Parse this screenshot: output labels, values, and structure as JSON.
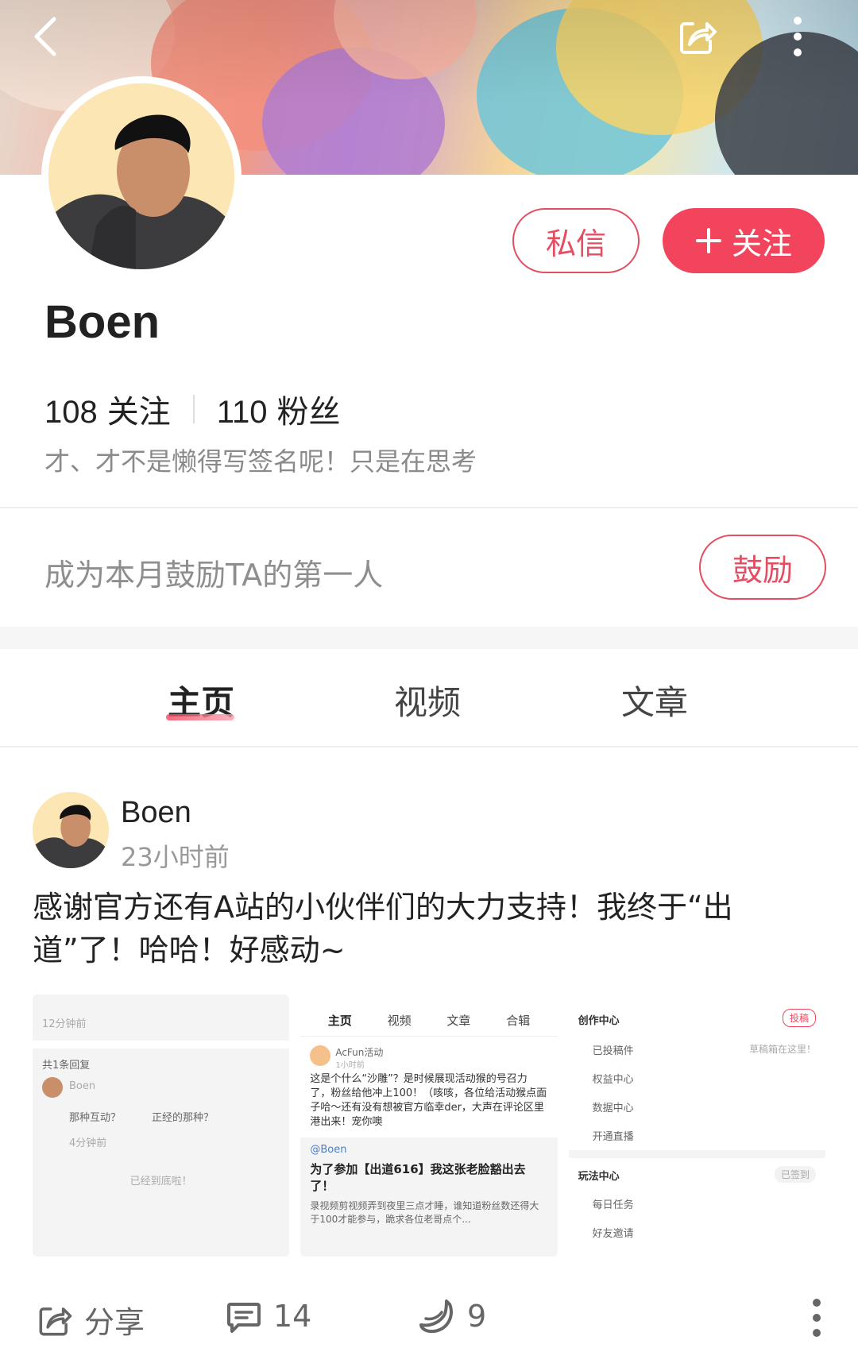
{
  "header": {
    "icons": {
      "back": "back-arrow-icon",
      "share": "share-icon",
      "more": "more-vertical-icon"
    }
  },
  "profile": {
    "name": "Boen",
    "message_button": "私信",
    "follow_button": "关注",
    "following_count": "108",
    "following_label": "关注",
    "fans_count": "110",
    "fans_label": "粉丝",
    "signature": "才、才不是懒得写签名呢！只是在思考"
  },
  "cheer": {
    "prompt": "成为本月鼓励TA的第一人",
    "button": "鼓励"
  },
  "tabs": [
    {
      "label": "主页",
      "active": true
    },
    {
      "label": "视频",
      "active": false
    },
    {
      "label": "文章",
      "active": false
    }
  ],
  "post": {
    "author": "Boen",
    "time": "23小时前",
    "text": "感谢官方还有A站的小伙伴们的大力支持！我终于“出道”了！哈哈！好感动~",
    "images": {
      "shot1": {
        "top_time": "12分钟前",
        "reply_header": "共1条回复",
        "reply_user": "Boen",
        "reply_text": "那种互动？",
        "reply_text2": "正经的那种？",
        "reply_time": "4分钟前",
        "end_text": "已经到底啦！"
      },
      "shot2": {
        "tabs": [
          "主页",
          "视频",
          "文章",
          "合辑"
        ],
        "user": "AcFun活动",
        "time": "1小时前",
        "text": "这是个什么“沙雕”？是时候展现活动猴的号召力了，粉丝给他冲上100！（咳咳，各位给活动猴点面子哈～还有没有想被官方临幸der，大声在评论区里港出来！宠你噢",
        "mention": "@Boen",
        "title": "为了参加【出道616】我这张老脸豁出去了！",
        "desc": "录视频剪视频弄到夜里三点才睡，谁知道粉丝数还得大于100才能参与，跪求各位老哥点个..."
      },
      "shot3": {
        "section1": "创作中心",
        "submit": "投稿",
        "item1": "已投稿件",
        "item1_hint": "草稿箱在这里！",
        "item2": "权益中心",
        "item3": "数据中心",
        "item4": "开通直播",
        "section2": "玩法中心",
        "signed": "已签到",
        "item5": "每日任务",
        "item6": "好友邀请"
      }
    }
  },
  "actions": {
    "share_label": "分享",
    "comment_count": "14",
    "banana_count": "9",
    "icons": {
      "share": "share-icon",
      "comment": "comment-icon",
      "banana": "banana-icon",
      "more": "more-vertical-icon"
    }
  },
  "colors": {
    "accent": "#f2455d",
    "text": "#222222",
    "muted": "#999999"
  }
}
